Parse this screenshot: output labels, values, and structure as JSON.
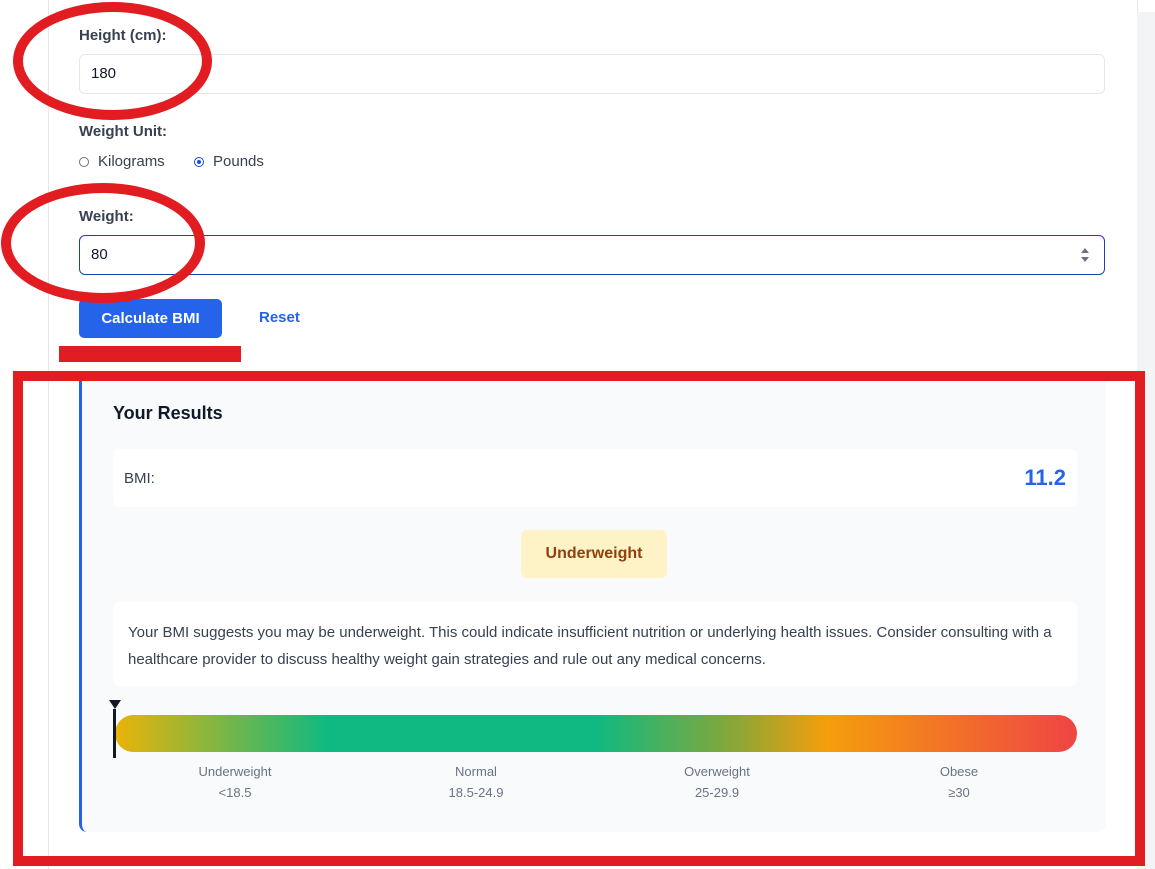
{
  "form": {
    "height_label": "Height (cm):",
    "height_value": "180",
    "weight_unit_label": "Weight Unit:",
    "unit_options": [
      {
        "label": "Kilograms",
        "checked": false
      },
      {
        "label": "Pounds",
        "checked": true
      }
    ],
    "weight_label": "Weight:",
    "weight_value": "80",
    "calculate_label": "Calculate BMI",
    "reset_label": "Reset"
  },
  "results": {
    "title": "Your Results",
    "bmi_label": "BMI:",
    "bmi_value": "11.2",
    "category": "Underweight",
    "advice": "Your BMI suggests you may be underweight. This could indicate insufficient nutrition or underlying health issues. Consider consulting with a healthcare provider to discuss healthy weight gain strategies and rule out any medical concerns.",
    "scale": [
      {
        "name": "Underweight",
        "range": "<18.5"
      },
      {
        "name": "Normal",
        "range": "18.5-24.9"
      },
      {
        "name": "Overweight",
        "range": "25-29.9"
      },
      {
        "name": "Obese",
        "range": "≥30"
      }
    ]
  },
  "colors": {
    "accent": "#2563eb",
    "annotation": "#e11d22",
    "badge_bg": "#fef3c7",
    "badge_text": "#92400e"
  }
}
